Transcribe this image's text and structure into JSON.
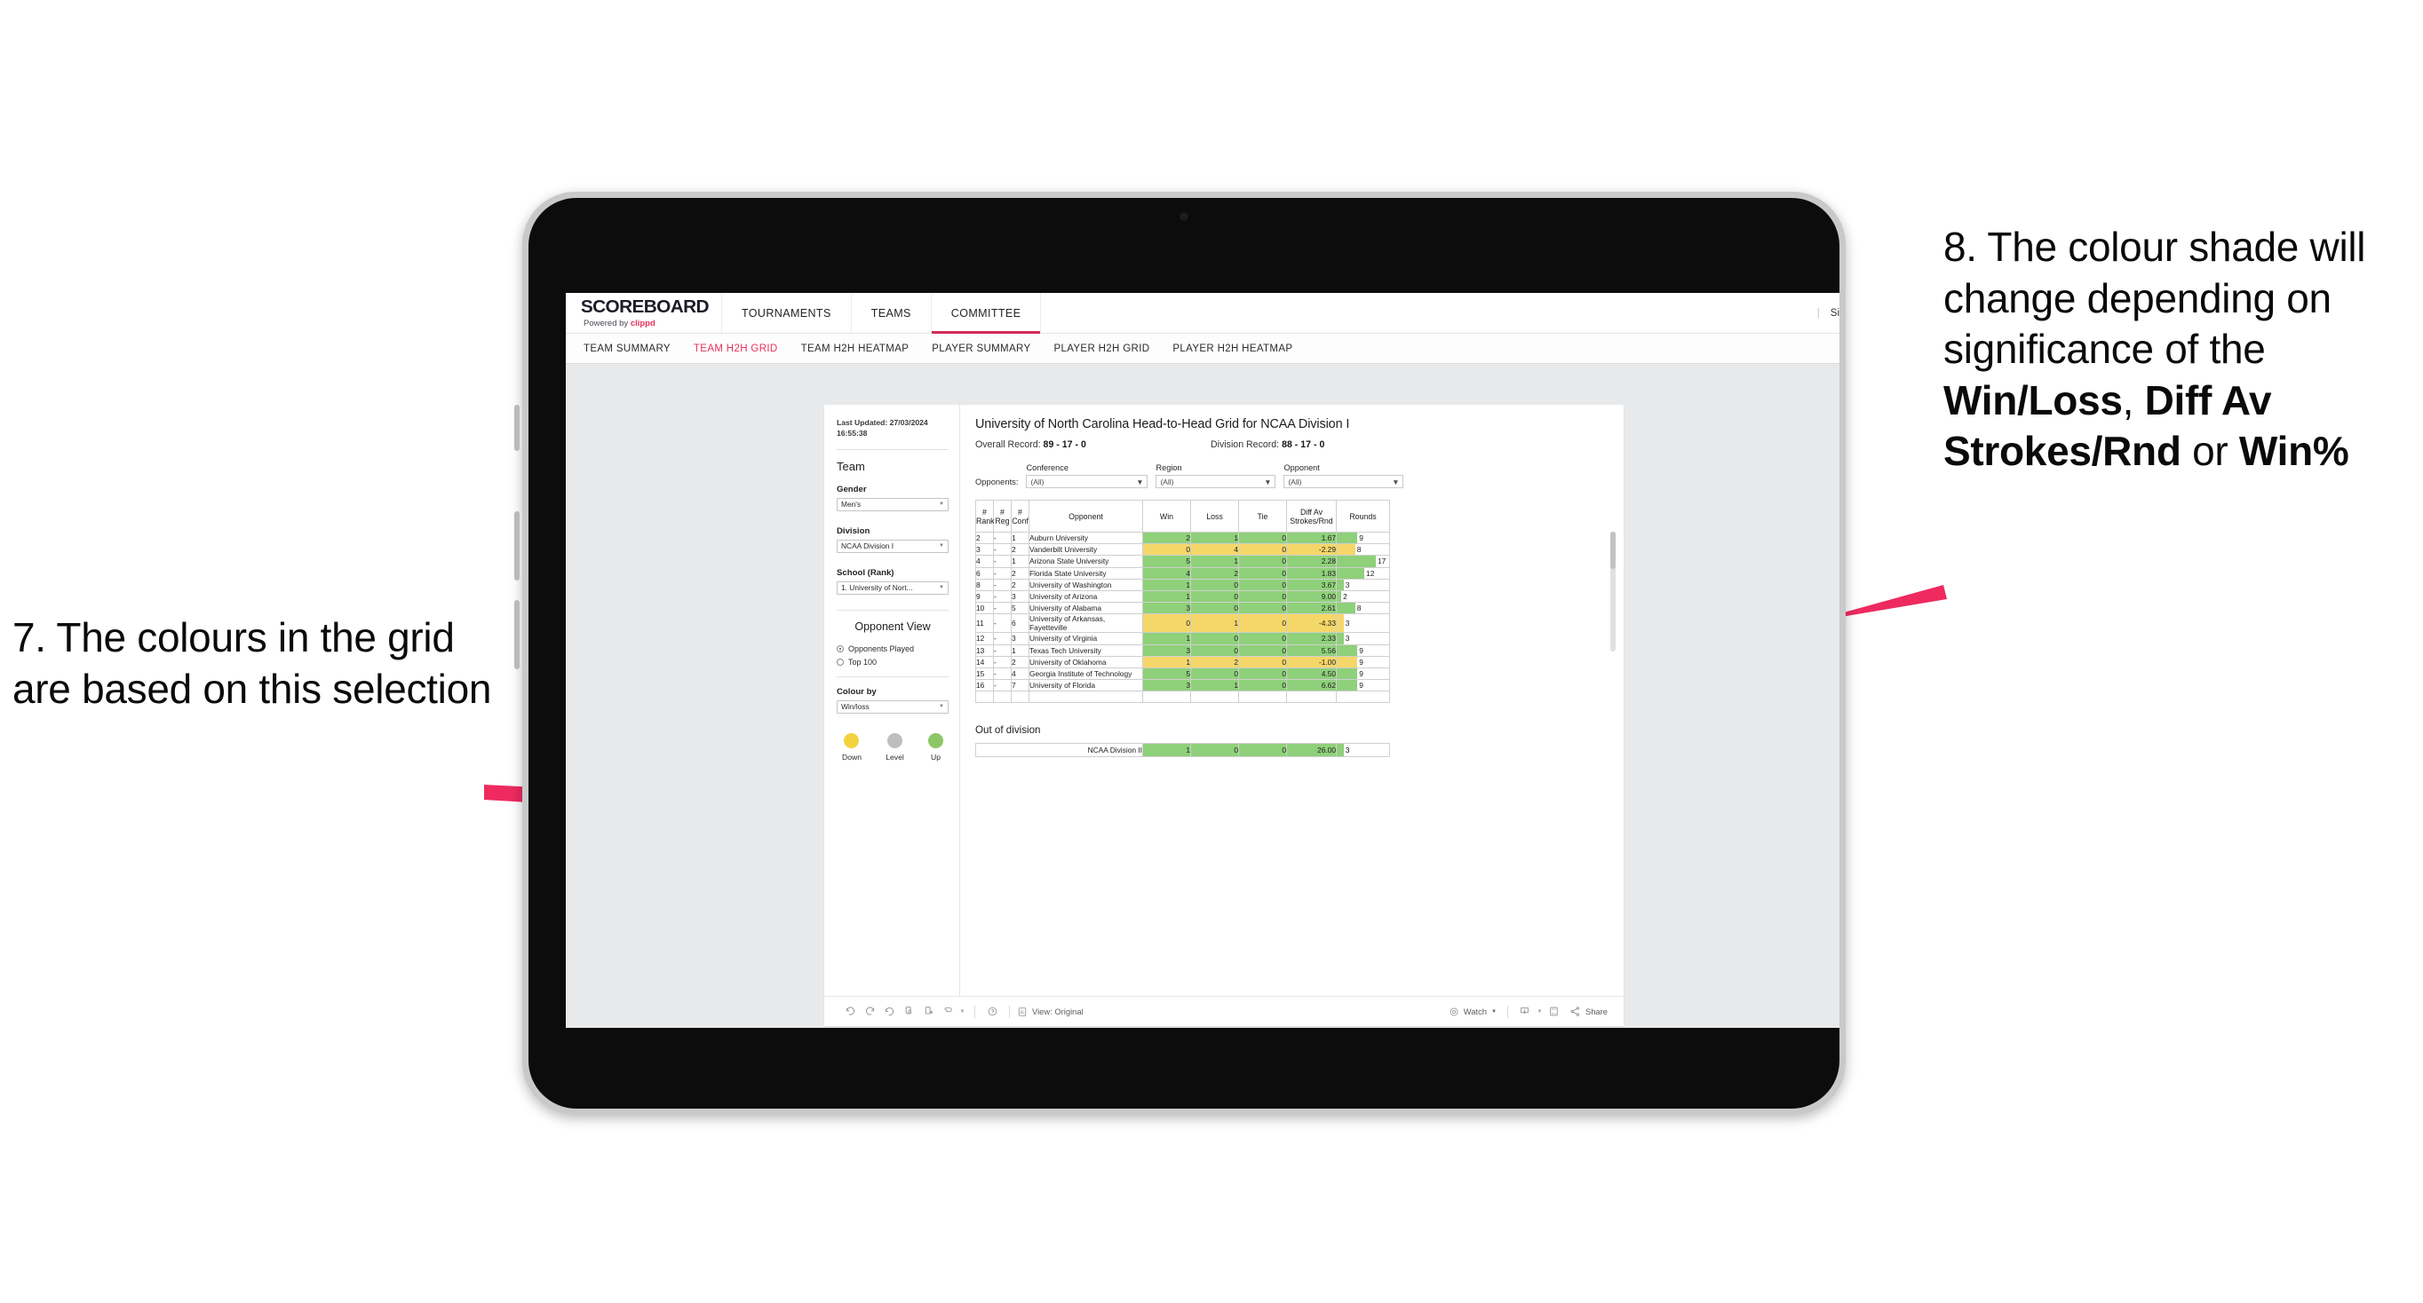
{
  "annotations": {
    "left": {
      "text": "7. The colours in the grid are based on this selection"
    },
    "right": {
      "part1": "8. The colour shade will change depending on significance of the ",
      "bold1": "Win/Loss",
      "mid1": ", ",
      "bold2": "Diff Av Strokes/Rnd",
      "mid2": " or ",
      "bold3": "Win%"
    },
    "arrow_color": "#ee2a5f"
  },
  "app": {
    "brand": {
      "name": "SCOREBOARD",
      "powered_prefix": "Powered by ",
      "powered_brand": "clippd"
    },
    "topnav": [
      {
        "label": "TOURNAMENTS",
        "active": false
      },
      {
        "label": "TEAMS",
        "active": false
      },
      {
        "label": "COMMITTEE",
        "active": true
      }
    ],
    "topnav_right": {
      "divider": "|",
      "sign_out": "Sign out"
    },
    "subnav": [
      {
        "label": "TEAM SUMMARY",
        "active": false
      },
      {
        "label": "TEAM H2H GRID",
        "active": true
      },
      {
        "label": "TEAM H2H HEATMAP",
        "active": false
      },
      {
        "label": "PLAYER SUMMARY",
        "active": false
      },
      {
        "label": "PLAYER H2H GRID",
        "active": false
      },
      {
        "label": "PLAYER H2H HEATMAP",
        "active": false
      }
    ],
    "accent": "#e8305a"
  },
  "sidebar": {
    "last_updated": "Last Updated: 27/03/2024 16:55:38",
    "team_heading": "Team",
    "gender": {
      "label": "Gender",
      "value": "Men's"
    },
    "division": {
      "label": "Division",
      "value": "NCAA Division I"
    },
    "school": {
      "label": "School (Rank)",
      "value": "1. University of Nort..."
    },
    "opponent_view": {
      "heading": "Opponent View",
      "options": [
        {
          "label": "Opponents Played",
          "selected": true
        },
        {
          "label": "Top 100",
          "selected": false
        }
      ]
    },
    "colour_by": {
      "label": "Colour by",
      "value": "Win/loss"
    },
    "legend": [
      {
        "label": "Down",
        "color": "#f2d23f"
      },
      {
        "label": "Level",
        "color": "#bcbec0"
      },
      {
        "label": "Up",
        "color": "#8cc765"
      }
    ]
  },
  "viz": {
    "title": "University of North Carolina Head-to-Head Grid for NCAA Division I",
    "overall_record_label": "Overall Record: ",
    "overall_record_value": "89 - 17 - 0",
    "division_record_label": "Division Record: ",
    "division_record_value": "88 - 17 - 0",
    "opponents_label": "Opponents:",
    "filters": [
      {
        "name": "Conference",
        "value": "(All)"
      },
      {
        "name": "Region",
        "value": "(All)"
      },
      {
        "name": "Opponent",
        "value": "(All)"
      }
    ],
    "columns": [
      "# Rank",
      "# Reg",
      "# Conf",
      "Opponent",
      "Win",
      "Loss",
      "Tie",
      "Diff Av Strokes/Rnd",
      "Rounds"
    ],
    "column_lines": [
      [
        "#",
        "Rank"
      ],
      [
        "#",
        "Reg"
      ],
      [
        "#",
        "Conf"
      ],
      [
        "Opponent"
      ],
      [
        "Win"
      ],
      [
        "Loss"
      ],
      [
        "Tie"
      ],
      [
        "Diff Av",
        "Strokes/Rnd"
      ],
      [
        "Rounds"
      ]
    ],
    "out_of_division_title": "Out of division",
    "out_of_division_row": {
      "name": "NCAA Division II",
      "win": "1",
      "loss": "0",
      "tie": "0",
      "diff": "26.00",
      "rounds": "3"
    },
    "toolbar": {
      "view_label": "View: Original",
      "watch_label": "Watch",
      "share_label": "Share"
    }
  },
  "chart_data": {
    "type": "table",
    "title": "University of North Carolina Head-to-Head Grid for NCAA Division I",
    "columns": [
      "# Rank",
      "# Reg",
      "# Conf",
      "Opponent",
      "Win",
      "Loss",
      "Tie",
      "Diff Av Strokes/Rnd",
      "Rounds"
    ],
    "rounds_max": 17,
    "colors": {
      "up": "#8fd07a",
      "down": "#f5d769",
      "level": "#bcbec0"
    },
    "rows": [
      {
        "rank": "2",
        "reg": "-",
        "conf": "1",
        "opponent": "Auburn University",
        "win": "2",
        "loss": "1",
        "tie": "0",
        "diff": "1.67",
        "rounds": "9",
        "state": "up"
      },
      {
        "rank": "3",
        "reg": "-",
        "conf": "2",
        "opponent": "Vanderbilt University",
        "win": "0",
        "loss": "4",
        "tie": "0",
        "diff": "-2.29",
        "rounds": "8",
        "state": "down"
      },
      {
        "rank": "4",
        "reg": "-",
        "conf": "1",
        "opponent": "Arizona State University",
        "win": "5",
        "loss": "1",
        "tie": "0",
        "diff": "2.28",
        "rounds": "17",
        "state": "up"
      },
      {
        "rank": "6",
        "reg": "-",
        "conf": "2",
        "opponent": "Florida State University",
        "win": "4",
        "loss": "2",
        "tie": "0",
        "diff": "1.83",
        "rounds": "12",
        "state": "up"
      },
      {
        "rank": "8",
        "reg": "-",
        "conf": "2",
        "opponent": "University of Washington",
        "win": "1",
        "loss": "0",
        "tie": "0",
        "diff": "3.67",
        "rounds": "3",
        "state": "up"
      },
      {
        "rank": "9",
        "reg": "-",
        "conf": "3",
        "opponent": "University of Arizona",
        "win": "1",
        "loss": "0",
        "tie": "0",
        "diff": "9.00",
        "rounds": "2",
        "state": "up"
      },
      {
        "rank": "10",
        "reg": "-",
        "conf": "5",
        "opponent": "University of Alabama",
        "win": "3",
        "loss": "0",
        "tie": "0",
        "diff": "2.61",
        "rounds": "8",
        "state": "up"
      },
      {
        "rank": "11",
        "reg": "-",
        "conf": "6",
        "opponent": "University of Arkansas, Fayetteville",
        "win": "0",
        "loss": "1",
        "tie": "0",
        "diff": "-4.33",
        "rounds": "3",
        "state": "down"
      },
      {
        "rank": "12",
        "reg": "-",
        "conf": "3",
        "opponent": "University of Virginia",
        "win": "1",
        "loss": "0",
        "tie": "0",
        "diff": "2.33",
        "rounds": "3",
        "state": "up"
      },
      {
        "rank": "13",
        "reg": "-",
        "conf": "1",
        "opponent": "Texas Tech University",
        "win": "3",
        "loss": "0",
        "tie": "0",
        "diff": "5.56",
        "rounds": "9",
        "state": "up"
      },
      {
        "rank": "14",
        "reg": "-",
        "conf": "2",
        "opponent": "University of Oklahoma",
        "win": "1",
        "loss": "2",
        "tie": "0",
        "diff": "-1.00",
        "rounds": "9",
        "state": "down"
      },
      {
        "rank": "15",
        "reg": "-",
        "conf": "4",
        "opponent": "Georgia Institute of Technology",
        "win": "5",
        "loss": "0",
        "tie": "0",
        "diff": "4.50",
        "rounds": "9",
        "state": "up"
      },
      {
        "rank": "16",
        "reg": "-",
        "conf": "7",
        "opponent": "University of Florida",
        "win": "3",
        "loss": "1",
        "tie": "0",
        "diff": "6.62",
        "rounds": "9",
        "state": "up"
      }
    ]
  }
}
